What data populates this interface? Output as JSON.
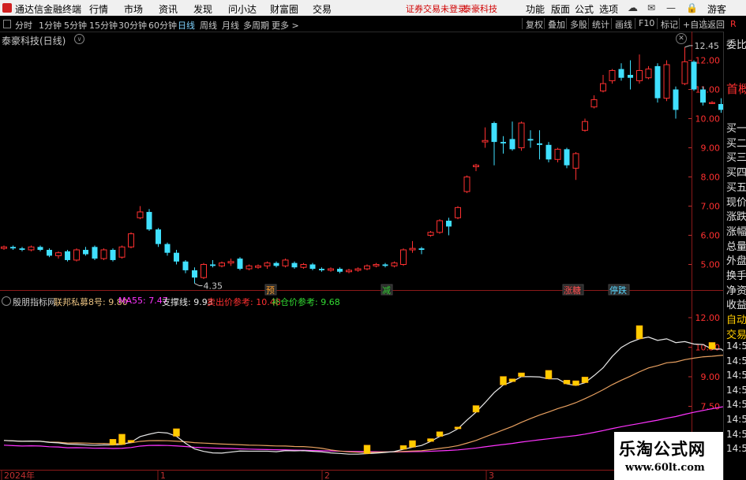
{
  "menubar": {
    "app_title": "通达信金融终端",
    "menus": [
      "行情",
      "市场",
      "资讯",
      "发现",
      "问小达",
      "财富圈",
      "交易"
    ],
    "notice": "证券交易未登录",
    "stock_name": "泰豪科技",
    "right_menus": [
      "功能",
      "版面",
      "公式",
      "选项"
    ],
    "guest": "游客"
  },
  "toolbar": {
    "periods": [
      "分时",
      "1分钟",
      "5分钟",
      "15分钟",
      "30分钟",
      "60分钟",
      "日线",
      "周线",
      "月线",
      "多周期",
      "更多 >"
    ],
    "active_period": "日线",
    "right_buttons": [
      "复权",
      "叠加",
      "多股",
      "统计",
      "画线",
      "F10",
      "标记",
      "+自选",
      "返回"
    ],
    "r_badge": "R"
  },
  "main_chart": {
    "title": "泰豪科技(日线)",
    "high_label": "12.45",
    "low_label": "4.35",
    "price_axis": [
      "12.00",
      "11.00",
      "10.00",
      "9.00",
      "8.00",
      "7.00",
      "6.00",
      "5.00"
    ],
    "markers": [
      {
        "text": "预",
        "color": "#ff9f2f"
      },
      {
        "text": "减",
        "color": "#33cc33"
      },
      {
        "text": "涨糖",
        "color": "#ff5050"
      },
      {
        "text": "停跌",
        "color": "#5ad7ff"
      }
    ]
  },
  "indicator": {
    "name": "殷朋指标网",
    "lines": [
      {
        "label": "联邦私募8号: 9.80",
        "color": "#e8c080"
      },
      {
        "label": "MA55: 7.47",
        "color": "#ff33ff"
      },
      {
        "label": "支撑线: 9.93",
        "color": "#e8e8e8"
      },
      {
        "label": "卖出价参考: 10.48",
        "color": "#ff3030"
      },
      {
        "label": "补仓价参考: 9.68",
        "color": "#33dd33"
      }
    ],
    "axis": [
      "12.00",
      "10.50",
      "9.00",
      "7.50"
    ]
  },
  "time_axis": {
    "labels": [
      "2024年",
      "1",
      "2",
      "3"
    ]
  },
  "right_panel": {
    "top_items": [
      "委比",
      "首概"
    ],
    "items": [
      "买一",
      "买二",
      "买三",
      "买四",
      "买五",
      "现价",
      "涨跌",
      "涨幅",
      "总量",
      "外盘",
      "换手",
      "净资",
      "收益",
      "自动",
      "交易"
    ],
    "times": [
      "14:56",
      "14:56",
      "14:56",
      "14:56",
      "14:56",
      "14:56",
      "14:56",
      "14:56"
    ]
  },
  "watermark": {
    "title": "乐淘公式网",
    "url": "www.60lt.com"
  },
  "chart_data": {
    "type": "candlestick",
    "title": "泰豪科技(日线)",
    "ylim": [
      4.2,
      12.8
    ],
    "y_ticks": [
      5,
      6,
      7,
      8,
      9,
      10,
      11,
      12
    ],
    "candles": [
      [
        5.55,
        5.6,
        5.5,
        5.65
      ],
      [
        5.6,
        5.55,
        5.5,
        5.65
      ],
      [
        5.55,
        5.5,
        5.45,
        5.6
      ],
      [
        5.5,
        5.6,
        5.45,
        5.65
      ],
      [
        5.6,
        5.5,
        5.45,
        5.65
      ],
      [
        5.5,
        5.3,
        5.25,
        5.55
      ],
      [
        5.3,
        5.4,
        5.2,
        5.45
      ],
      [
        5.45,
        5.15,
        5.1,
        5.5
      ],
      [
        5.15,
        5.5,
        5.1,
        5.55
      ],
      [
        5.5,
        5.35,
        5.3,
        5.6
      ],
      [
        5.6,
        5.2,
        5.15,
        5.65
      ],
      [
        5.2,
        5.5,
        5.15,
        5.55
      ],
      [
        5.5,
        5.15,
        5.1,
        5.55
      ],
      [
        5.25,
        5.6,
        5.2,
        5.65
      ],
      [
        5.6,
        6.05,
        5.55,
        6.1
      ],
      [
        6.6,
        6.8,
        6.55,
        7.0
      ],
      [
        6.8,
        6.2,
        6.15,
        6.9
      ],
      [
        6.2,
        5.7,
        5.6,
        6.25
      ],
      [
        5.7,
        5.4,
        5.3,
        5.75
      ],
      [
        5.4,
        5.1,
        5.0,
        5.5
      ],
      [
        5.1,
        4.8,
        4.7,
        5.15
      ],
      [
        4.8,
        4.55,
        4.35,
        4.9
      ],
      [
        4.55,
        5.0,
        4.5,
        5.05
      ],
      [
        5.0,
        4.95,
        4.9,
        5.15
      ],
      [
        4.95,
        5.05,
        4.9,
        5.1
      ],
      [
        5.05,
        5.1,
        4.95,
        5.2
      ],
      [
        5.2,
        4.85,
        4.8,
        5.25
      ],
      [
        4.85,
        4.95,
        4.8,
        5.0
      ],
      [
        4.9,
        4.95,
        4.85,
        5.0
      ],
      [
        4.95,
        5.05,
        4.85,
        5.1
      ],
      [
        5.05,
        4.95,
        4.9,
        5.1
      ],
      [
        4.95,
        5.15,
        4.9,
        5.2
      ],
      [
        5.05,
        4.9,
        4.85,
        5.1
      ],
      [
        4.9,
        5.0,
        4.85,
        5.05
      ],
      [
        5.0,
        4.85,
        4.8,
        5.05
      ],
      [
        4.85,
        4.8,
        4.75,
        4.9
      ],
      [
        4.8,
        4.85,
        4.75,
        4.9
      ],
      [
        4.85,
        4.75,
        4.7,
        4.9
      ],
      [
        4.75,
        4.8,
        4.7,
        4.85
      ],
      [
        4.8,
        4.85,
        4.75,
        4.9
      ],
      [
        4.85,
        4.95,
        4.8,
        5.0
      ],
      [
        4.95,
        5.0,
        4.9,
        5.05
      ],
      [
        5.0,
        4.95,
        4.9,
        5.05
      ],
      [
        4.95,
        5.05,
        4.9,
        5.1
      ],
      [
        5.0,
        5.5,
        4.95,
        5.55
      ],
      [
        5.5,
        5.55,
        5.4,
        5.8
      ],
      [
        5.55,
        5.5,
        5.35,
        5.6
      ],
      [
        6.0,
        6.1,
        5.95,
        6.15
      ],
      [
        6.1,
        6.5,
        6.05,
        6.55
      ],
      [
        6.5,
        6.3,
        6.0,
        6.6
      ],
      [
        6.6,
        6.95,
        6.55,
        7.0
      ],
      [
        7.5,
        8.0,
        7.45,
        8.05
      ],
      [
        8.35,
        8.4,
        8.2,
        8.45
      ],
      [
        9.2,
        9.25,
        9.0,
        9.7
      ],
      [
        9.85,
        9.2,
        8.4,
        9.9
      ],
      [
        9.2,
        9.15,
        8.8,
        9.4
      ],
      [
        9.3,
        8.95,
        8.9,
        9.9
      ],
      [
        9.0,
        9.85,
        8.9,
        9.9
      ],
      [
        9.3,
        9.25,
        9.0,
        9.6
      ],
      [
        9.15,
        9.1,
        8.6,
        9.6
      ],
      [
        9.1,
        8.6,
        8.5,
        9.2
      ],
      [
        8.6,
        8.95,
        8.5,
        9.0
      ],
      [
        8.95,
        8.4,
        8.3,
        9.0
      ],
      [
        8.3,
        8.8,
        7.9,
        8.85
      ],
      [
        9.6,
        9.9,
        9.55,
        10.0
      ],
      [
        10.4,
        10.65,
        10.35,
        10.8
      ],
      [
        10.95,
        11.2,
        10.9,
        11.5
      ],
      [
        11.3,
        11.65,
        11.2,
        11.7
      ],
      [
        11.7,
        11.4,
        11.3,
        11.9
      ],
      [
        11.5,
        11.4,
        11.0,
        12.0
      ],
      [
        11.3,
        11.65,
        11.2,
        12.2
      ],
      [
        11.4,
        11.7,
        11.35,
        11.8
      ],
      [
        11.8,
        10.7,
        10.55,
        11.9
      ],
      [
        10.7,
        11.85,
        10.6,
        12.0
      ],
      [
        11.0,
        10.3,
        10.0,
        11.1
      ],
      [
        11.2,
        11.95,
        11.15,
        12.45
      ],
      [
        11.95,
        11.0,
        10.95,
        12.0
      ],
      [
        11.0,
        10.55,
        10.45,
        11.1
      ],
      [
        10.55,
        10.55,
        10.5,
        10.6
      ],
      [
        10.5,
        10.3,
        10.2,
        10.7
      ],
      [
        10.25,
        9.9,
        9.8,
        10.3
      ],
      [
        9.9,
        9.6,
        9.55,
        10.0
      ],
      [
        8.5,
        8.45,
        8.4,
        8.55
      ],
      [
        7.8,
        8.9,
        7.75,
        9.4
      ],
      [
        9.0,
        9.4,
        8.95,
        10.0
      ],
      [
        9.4,
        9.6,
        9.35,
        9.9
      ],
      [
        9.8,
        10.5,
        9.75,
        10.55
      ]
    ]
  }
}
